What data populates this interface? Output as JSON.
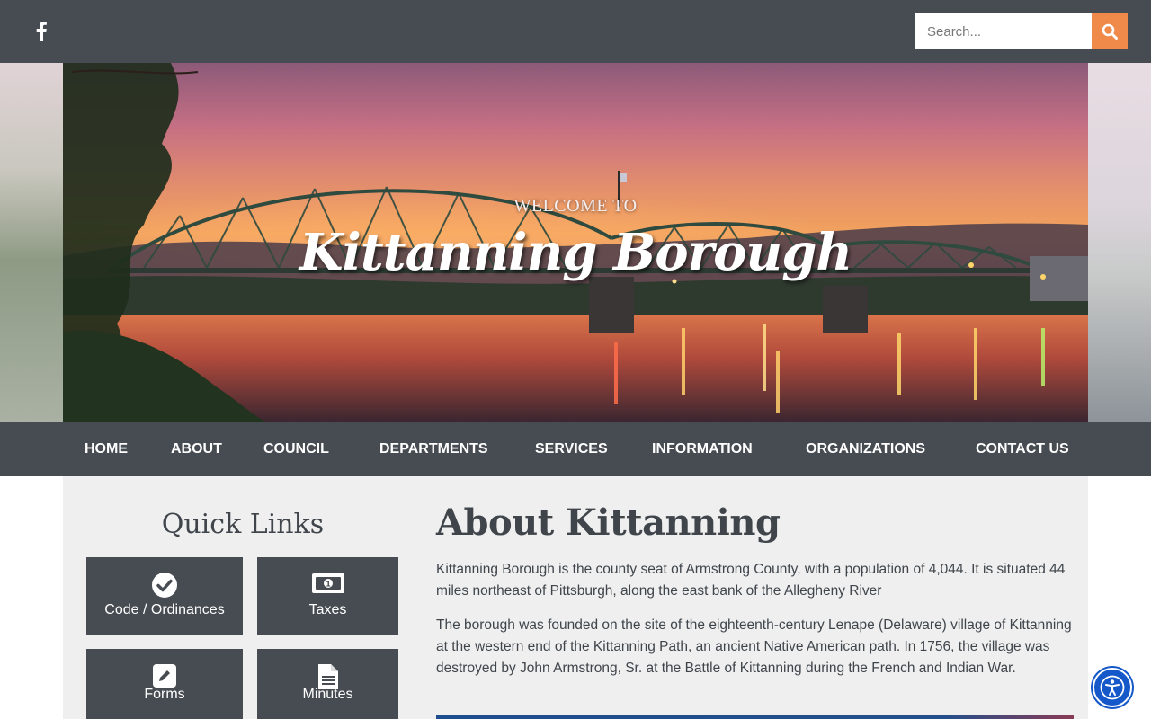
{
  "header": {
    "social_icon": "facebook-icon",
    "search": {
      "placeholder": "Search...",
      "button_icon": "search-icon",
      "button_color": "#f08a4b"
    },
    "background": "#474c52"
  },
  "hero": {
    "welcome": "WELCOME TO",
    "title": "Kittanning Borough"
  },
  "nav": {
    "items": [
      {
        "label": "HOME"
      },
      {
        "label": "ABOUT"
      },
      {
        "label": "COUNCIL"
      },
      {
        "label": "DEPARTMENTS"
      },
      {
        "label": "SERVICES"
      },
      {
        "label": "INFORMATION"
      },
      {
        "label": "ORGANIZATIONS"
      },
      {
        "label": "CONTACT US"
      }
    ]
  },
  "quick_links": {
    "title": "Quick Links",
    "tiles": [
      {
        "label": "Code / Ordinances",
        "icon": "check-circle-icon"
      },
      {
        "label": "Taxes",
        "icon": "money-bill-icon"
      },
      {
        "label": "Forms",
        "icon": "edit-icon"
      },
      {
        "label": "Minutes",
        "icon": "document-icon"
      }
    ]
  },
  "about": {
    "title": "About Kittanning",
    "paragraphs": [
      "Kittanning Borough is the county seat of Armstrong County, with a population of 4,044. It is situated 44 miles northeast of Pittsburgh, along the east bank of the Allegheny River",
      "The borough was founded on the site of the eighteenth-century Lenape (Delaware) village of Kittanning at the western end of the Kittanning Path, an ancient Native American path. In 1756, the village was destroyed by John Armstrong, Sr. at the Battle of Kittanning during the French and Indian War."
    ]
  },
  "accessibility": {
    "icon": "accessibility-icon"
  },
  "colors": {
    "dark": "#474c52",
    "accent": "#f08a4b",
    "text": "#3f454b",
    "panel": "#efefef",
    "a11y": "#1458c9"
  }
}
